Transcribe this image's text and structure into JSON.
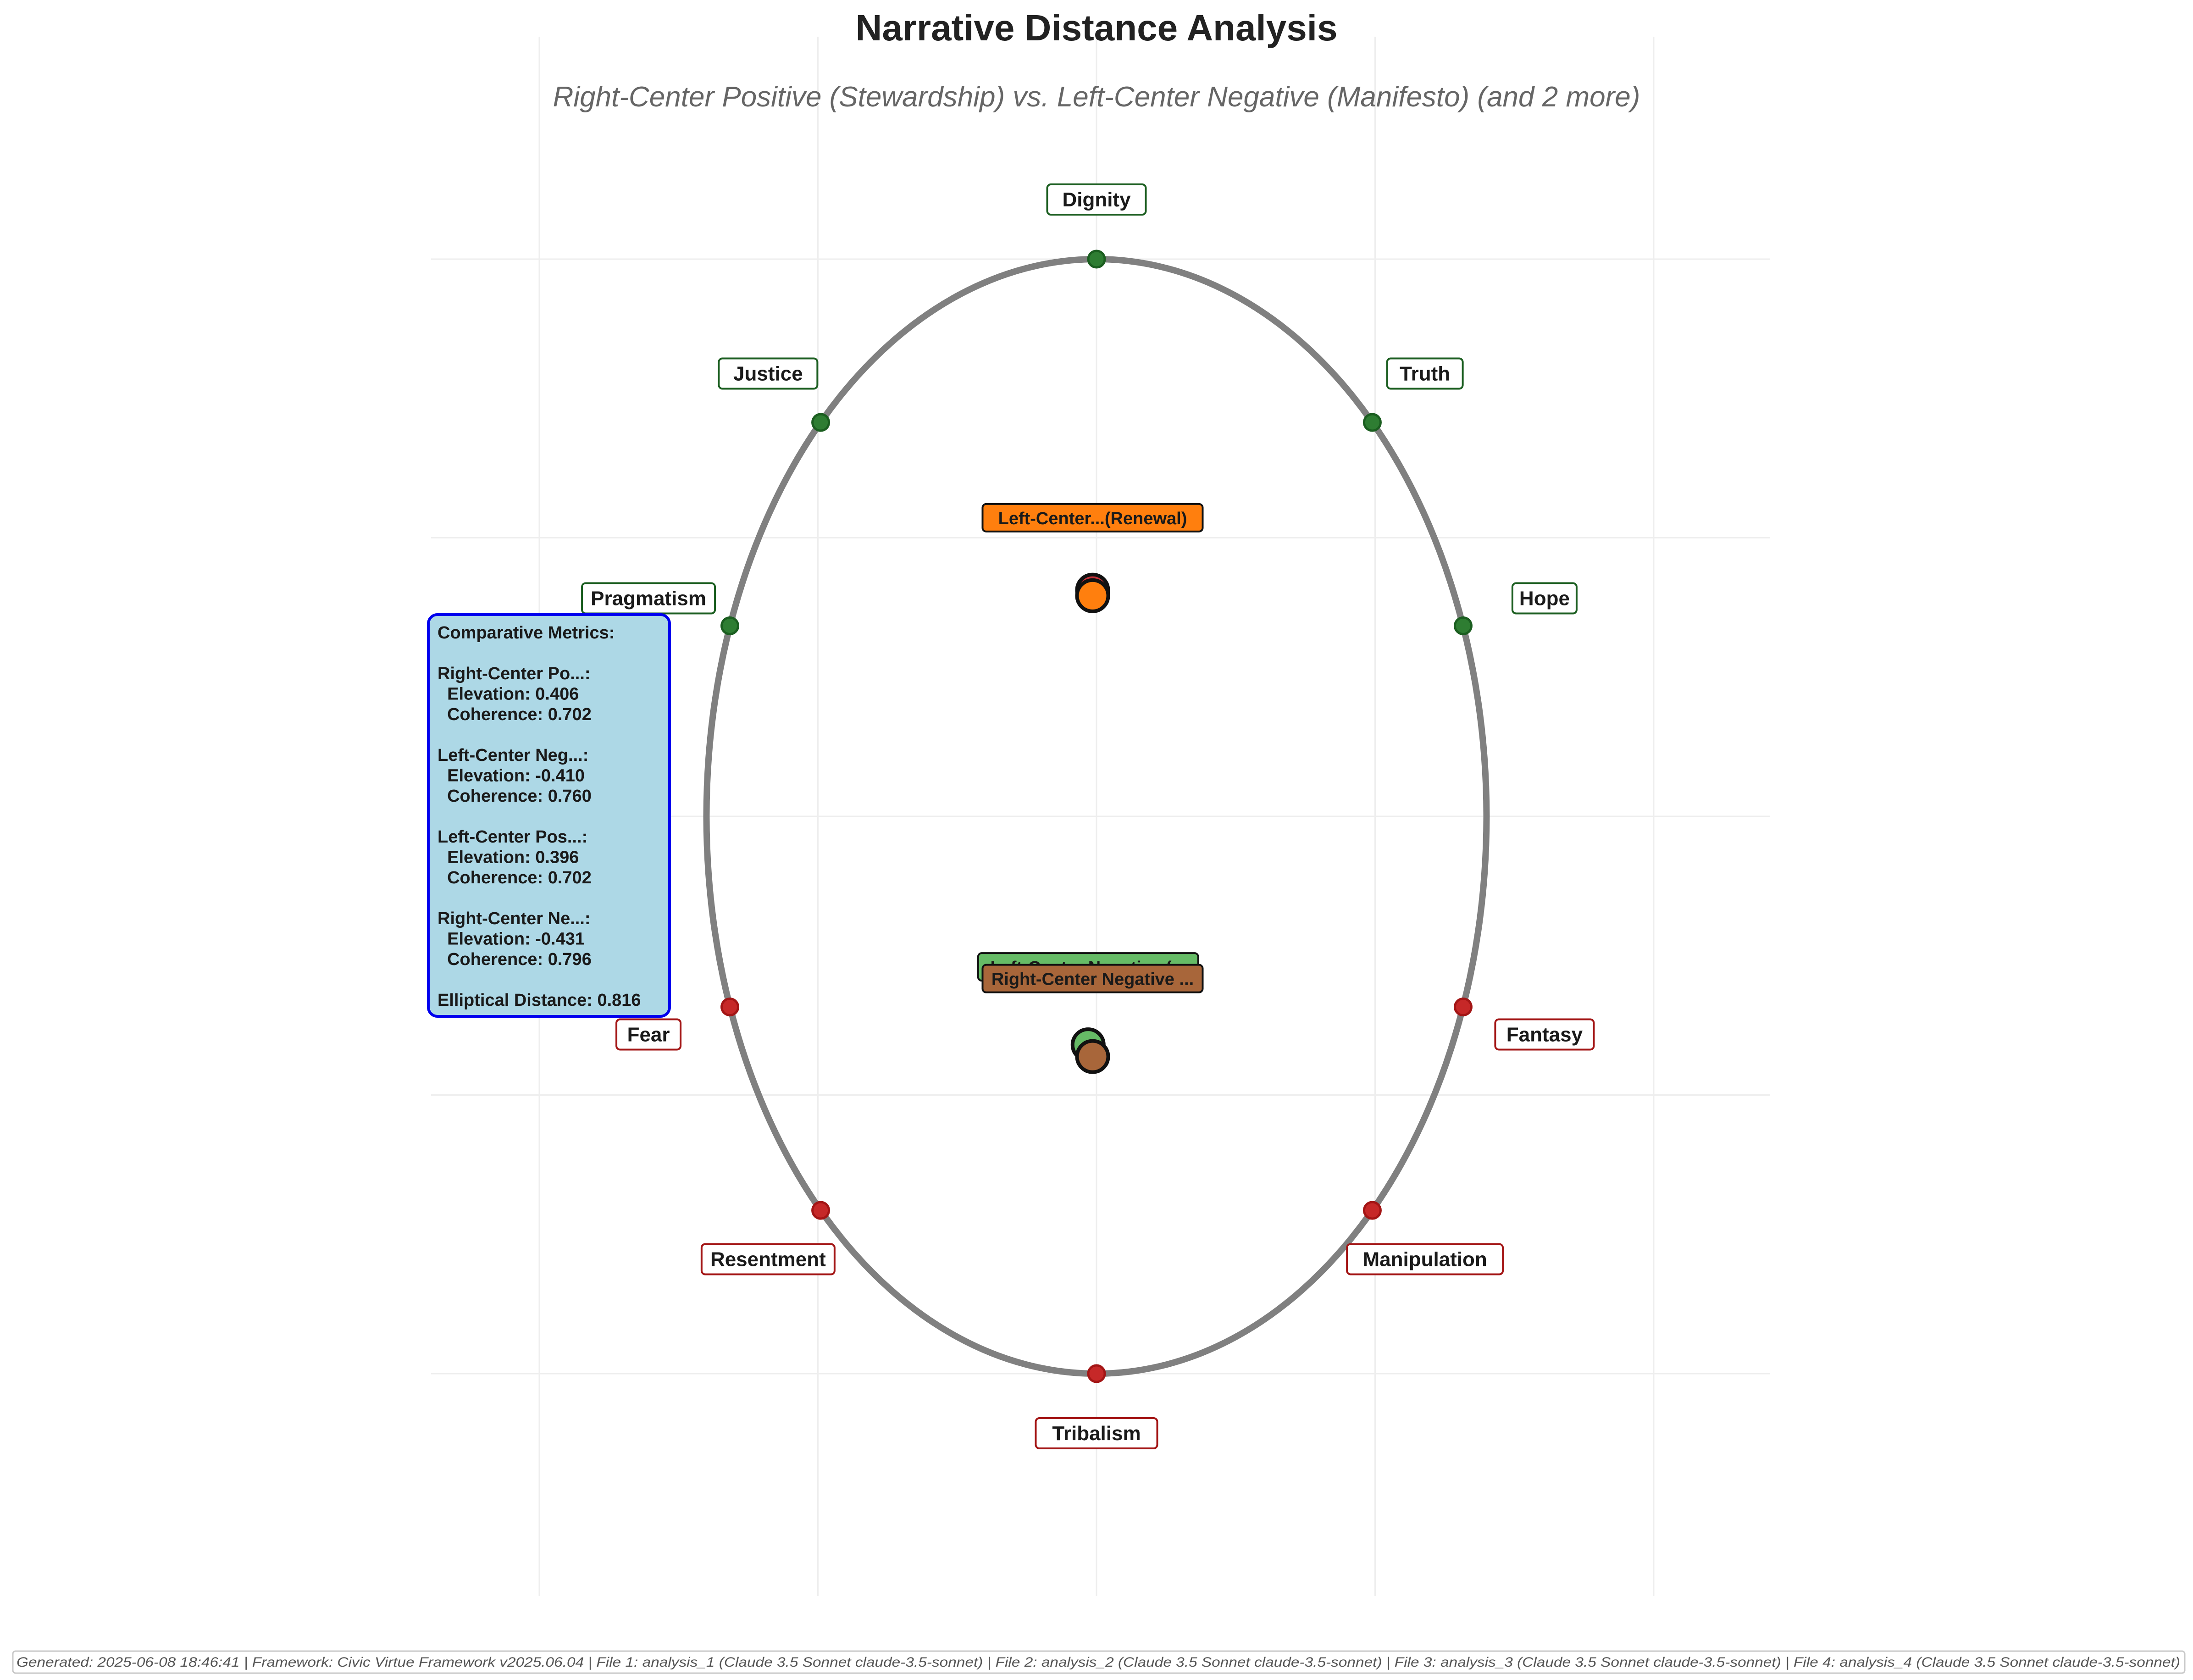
{
  "chart_data": {
    "type": "scatter",
    "title": "Narrative Distance Analysis",
    "subtitle": "Right-Center Positive (Stewardship) vs. Left-Center Negative (Manifesto) (and 2 more)",
    "ellipse": {
      "semi_major": 1.0,
      "semi_minor": 0.7
    },
    "xlim": [
      -1.2,
      1.2
    ],
    "ylim": [
      -1.2,
      1.2
    ],
    "grid": true,
    "wells": [
      {
        "name": "Dignity",
        "type": "integrative",
        "x": 0.0,
        "y": 1.0
      },
      {
        "name": "Truth",
        "type": "integrative",
        "x": 0.495,
        "y": 0.707
      },
      {
        "name": "Hope",
        "type": "integrative",
        "x": 0.658,
        "y": 0.342
      },
      {
        "name": "Justice",
        "type": "integrative",
        "x": -0.495,
        "y": 0.707
      },
      {
        "name": "Pragmatism",
        "type": "integrative",
        "x": -0.658,
        "y": 0.342
      },
      {
        "name": "Tribalism",
        "type": "disintegrative",
        "x": 0.0,
        "y": -1.0
      },
      {
        "name": "Manipulation",
        "type": "disintegrative",
        "x": 0.495,
        "y": -0.707
      },
      {
        "name": "Fantasy",
        "type": "disintegrative",
        "x": 0.658,
        "y": -0.342
      },
      {
        "name": "Resentment",
        "type": "disintegrative",
        "x": -0.495,
        "y": -0.707
      },
      {
        "name": "Fear",
        "type": "disintegrative",
        "x": -0.658,
        "y": -0.342
      }
    ],
    "narratives": [
      {
        "label": "Left-Center Negative (...",
        "x": -0.015,
        "y": -0.41,
        "color": "#66bb66"
      },
      {
        "label": "Right-Center Negative ...",
        "x": -0.007,
        "y": -0.431,
        "color": "#a8663a"
      },
      {
        "label": "",
        "x": -0.007,
        "y": 0.406,
        "color": "#c8323a"
      },
      {
        "label": "Left-Center...(Renewal)",
        "x": -0.007,
        "y": 0.396,
        "color": "#ff7f0e"
      }
    ],
    "metrics": {
      "heading": "Comparative Metrics:",
      "lines": [
        "Right-Center Po...:",
        "  Elevation: 0.406",
        "  Coherence: 0.702",
        "",
        "Left-Center Neg...:",
        "  Elevation: -0.410",
        "  Coherence: 0.760",
        "",
        "Left-Center Pos...:",
        "  Elevation: 0.396",
        "  Coherence: 0.702",
        "",
        "Right-Center Ne...:",
        "  Elevation: -0.431",
        "  Coherence: 0.796",
        "",
        "Elliptical Distance: 0.816"
      ]
    },
    "footer": "Generated: 2025-06-08 18:46:41 | Framework: Civic Virtue Framework v2025.06.04 | File 1: analysis_1 (Claude 3.5 Sonnet claude-3.5-sonnet) | File 2: analysis_2 (Claude 3.5 Sonnet claude-3.5-sonnet) | File 3: analysis_3 (Claude 3.5 Sonnet claude-3.5-sonnet) | File 4: analysis_4 (Claude 3.5 Sonnet claude-3.5-sonnet)"
  },
  "colors": {
    "integrative": "#2e7d32",
    "integrative_edge": "#1b5e20",
    "disintegrative": "#c62828",
    "disintegrative_edge": "#a31515",
    "ellipse": "#808080",
    "grid": "#eeeeee",
    "metrics_fill": "#add8e6",
    "metrics_edge": "#0000ee"
  }
}
